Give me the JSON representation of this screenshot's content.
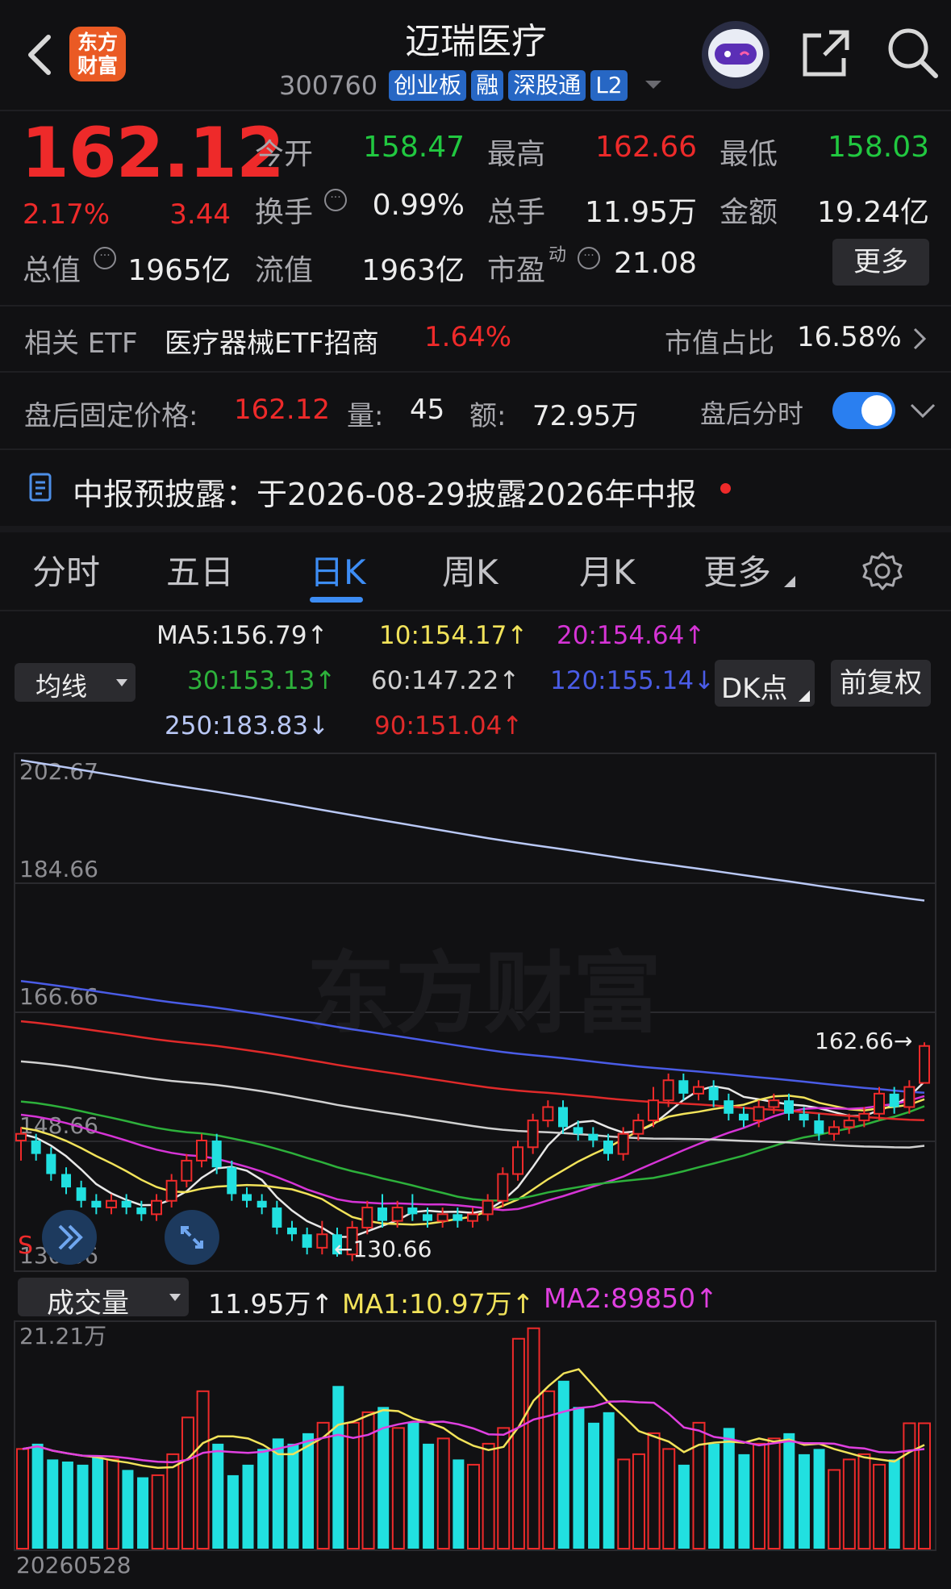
{
  "header": {
    "logo_text_line1": "东方",
    "logo_text_line2": "财富",
    "stock_name": "迈瑞医疗",
    "stock_code": "300760",
    "tags": [
      "创业板",
      "融",
      "深股通",
      "L2"
    ]
  },
  "quote": {
    "price": "162.12",
    "change_pct": "2.17%",
    "change": "3.44",
    "open_label": "今开",
    "open": "158.47",
    "high_label": "最高",
    "high": "162.66",
    "low_label": "最低",
    "low": "158.03",
    "turnover_label": "换手",
    "turnover": "0.99%",
    "volume_label": "总手",
    "volume": "11.95万",
    "amount_label": "金额",
    "amount": "19.24亿",
    "mktcap_label": "总值",
    "mktcap": "1965亿",
    "float_label": "流值",
    "float_cap": "1963亿",
    "pe_label": "市盈",
    "pe_sup": "动",
    "pe": "21.08",
    "more_button": "更多"
  },
  "etf": {
    "label": "相关 ETF",
    "name": "医疗器械ETF招商",
    "pct": "1.64%",
    "ratio_label": "市值占比",
    "ratio": "16.58%"
  },
  "after_hours": {
    "price_label": "盘后固定价格:",
    "price": "162.12",
    "vol_label": "量:",
    "vol": "45",
    "amt_label": "额:",
    "amt": "72.95万",
    "toggle_label": "盘后分时",
    "toggle_on": true
  },
  "notice": {
    "text": "中报预披露：于2026-08-29披露2026年中报"
  },
  "chart_tabs": [
    "分时",
    "五日",
    "日K",
    "周K",
    "月K",
    "更多"
  ],
  "chart_tabs_selected": "日K",
  "ma_panel": {
    "select_label": "均线",
    "dk_button": "DK点",
    "fq_button": "前复权",
    "items": [
      {
        "text": "MA5:156.79",
        "arrow": "↑",
        "color": "#e8e8e8"
      },
      {
        "text": "10:154.17",
        "arrow": "↑",
        "color": "#f2e35a"
      },
      {
        "text": "20:154.64",
        "arrow": "↑",
        "color": "#d634d6"
      },
      {
        "text": "30:153.13",
        "arrow": "↑",
        "color": "#2db13b"
      },
      {
        "text": "60:147.22",
        "arrow": "↑",
        "color": "#d0d0d0"
      },
      {
        "text": "120:155.14",
        "arrow": "↓",
        "color": "#4a5ce6"
      },
      {
        "text": "250:183.83",
        "arrow": "↓",
        "color": "#b9c8f5"
      },
      {
        "text": "90:151.04",
        "arrow": "↑",
        "color": "#e02a2a"
      }
    ]
  },
  "kline": {
    "y_labels": [
      "202.67",
      "184.66",
      "166.66",
      "148.66",
      "130.66"
    ],
    "max_label": "162.66→",
    "min_label": "←130.66",
    "watermark": "东方财富",
    "s_marker": "S"
  },
  "volume_panel": {
    "select_label": "成交量",
    "vol": "11.95万",
    "vol_arrow": "↑",
    "ma1": "MA1:10.97万",
    "ma1_arrow": "↑",
    "ma2": "MA2:89850",
    "ma2_arrow": "↑",
    "y_max": "21.21万",
    "date": "20260528"
  },
  "colors": {
    "up": "#ee2a2a",
    "down": "#21e0e0",
    "accent": "#2767c4",
    "bg": "#111113"
  },
  "chart_data": [
    {
      "type": "candlestick",
      "title": "日K",
      "ylim": [
        130.66,
        202.67
      ],
      "y_ticks": [
        202.67,
        184.66,
        166.66,
        148.66,
        130.66
      ],
      "high": 162.66,
      "low": 130.66,
      "candles": [
        [
          148,
          149,
          145,
          150
        ],
        [
          148,
          146,
          145,
          149
        ],
        [
          146,
          143,
          142,
          147
        ],
        [
          143,
          141,
          140,
          144
        ],
        [
          141,
          139,
          138,
          142
        ],
        [
          139,
          138,
          137,
          140
        ],
        [
          138,
          139,
          137,
          140
        ],
        [
          139,
          138,
          137,
          140
        ],
        [
          138,
          137,
          136,
          139
        ],
        [
          137,
          139,
          136,
          140
        ],
        [
          139,
          142,
          138,
          143
        ],
        [
          142,
          145,
          141,
          146
        ],
        [
          145,
          148,
          144,
          149
        ],
        [
          148,
          144,
          143,
          149
        ],
        [
          144,
          140,
          139,
          145
        ],
        [
          140,
          139,
          138,
          141
        ],
        [
          139,
          138,
          137,
          140
        ],
        [
          138,
          135,
          134,
          139
        ],
        [
          135,
          134,
          133,
          136
        ],
        [
          134,
          132,
          131,
          135
        ],
        [
          132,
          134,
          131,
          136
        ],
        [
          134,
          131,
          130.66,
          135
        ],
        [
          131,
          135,
          130,
          136
        ],
        [
          135,
          138,
          134,
          139
        ],
        [
          138,
          136,
          135,
          140
        ],
        [
          136,
          138,
          135,
          139
        ],
        [
          138,
          137,
          136,
          140
        ],
        [
          137,
          136,
          135,
          138
        ],
        [
          136,
          137,
          135,
          138
        ],
        [
          137,
          136,
          135,
          138
        ],
        [
          136,
          137,
          135,
          138
        ],
        [
          137,
          139,
          136,
          140
        ],
        [
          139,
          143,
          138,
          144
        ],
        [
          143,
          147,
          142,
          148
        ],
        [
          147,
          151,
          146,
          152
        ],
        [
          151,
          153,
          150,
          154
        ],
        [
          153,
          150,
          149,
          154
        ],
        [
          150,
          149,
          148,
          151
        ],
        [
          149,
          148,
          147,
          150
        ],
        [
          148,
          146,
          145,
          149
        ],
        [
          146,
          149,
          145,
          150
        ],
        [
          149,
          151,
          148,
          152
        ],
        [
          151,
          154,
          150,
          156
        ],
        [
          154,
          157,
          153,
          158
        ],
        [
          157,
          155,
          154,
          158
        ],
        [
          155,
          156,
          154,
          157
        ],
        [
          156,
          154,
          153,
          157
        ],
        [
          154,
          152,
          151,
          155
        ],
        [
          152,
          151,
          150,
          153
        ],
        [
          151,
          153,
          150,
          154
        ],
        [
          153,
          154,
          152,
          155
        ],
        [
          154,
          152,
          151,
          155
        ],
        [
          152,
          151,
          150,
          153
        ],
        [
          151,
          149,
          148,
          152
        ],
        [
          149,
          150,
          148,
          151
        ],
        [
          150,
          151,
          149,
          152
        ],
        [
          151,
          152,
          150,
          153
        ],
        [
          152,
          155,
          151,
          156
        ],
        [
          155,
          153,
          152,
          156
        ],
        [
          153,
          156,
          152,
          157
        ],
        [
          156.6,
          162.12,
          158.03,
          162.66
        ]
      ],
      "candle_fields": [
        "open",
        "close",
        "low",
        "high"
      ],
      "series": [
        {
          "name": "MA5",
          "last": 156.79
        },
        {
          "name": "MA10",
          "last": 154.17
        },
        {
          "name": "MA20",
          "last": 154.64
        },
        {
          "name": "MA30",
          "last": 153.13
        },
        {
          "name": "MA60",
          "last": 147.22
        },
        {
          "name": "MA90",
          "last": 151.04
        },
        {
          "name": "MA120",
          "last": 155.14
        },
        {
          "name": "MA250",
          "last": 183.83
        }
      ]
    },
    {
      "type": "bar",
      "title": "成交量",
      "y_max_label": "21.21万",
      "ylim": [
        0,
        21.21
      ],
      "x_last": "20260528",
      "values": [
        9.5,
        10.0,
        8.5,
        8.3,
        8.0,
        8.7,
        8.5,
        7.5,
        6.8,
        7.0,
        9.0,
        12.5,
        15.0,
        10.0,
        7.0,
        8.0,
        9.5,
        10.5,
        10.0,
        11.0,
        12.0,
        15.5,
        12.0,
        13.0,
        13.5,
        11.5,
        12.0,
        10.0,
        10.5,
        8.5,
        8.0,
        10.0,
        11.5,
        20.0,
        21.0,
        15.0,
        16.0,
        13.5,
        12.0,
        13.0,
        8.5,
        9.0,
        11.0,
        9.5,
        8.0,
        12.0,
        10.0,
        11.5,
        9.0,
        10.0,
        10.5,
        11.0,
        9.0,
        9.5,
        7.5,
        8.5,
        9.0,
        8.0,
        8.5,
        11.95,
        11.95
      ],
      "series": [
        {
          "name": "MA1",
          "last": "10.97万"
        },
        {
          "name": "MA2",
          "last": "89850"
        }
      ]
    }
  ]
}
